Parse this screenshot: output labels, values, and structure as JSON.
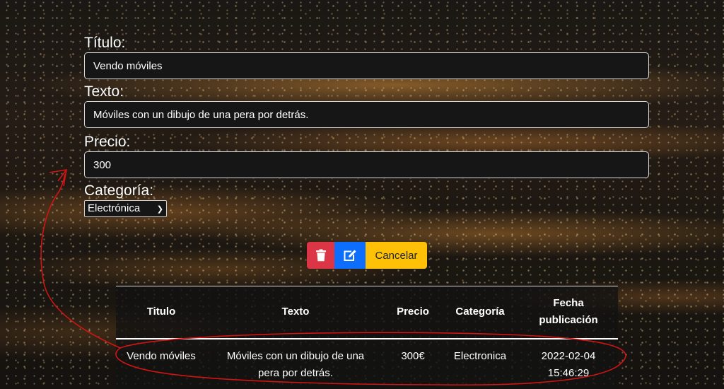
{
  "form": {
    "titulo_label": "Título:",
    "titulo_value": "Vendo móviles",
    "texto_label": "Texto:",
    "texto_value": "Móviles con un dibujo de una pera por detrás.",
    "precio_label": "Precio:",
    "precio_value": "300",
    "categoria_label": "Categoría:",
    "categoria_selected": "Electrónica"
  },
  "buttons": {
    "delete_icon": "trash-icon",
    "edit_icon": "edit-icon",
    "cancel_label": "Cancelar"
  },
  "table": {
    "headers": [
      "Titulo",
      "Texto",
      "Precio",
      "Categoría",
      "Fecha publicación"
    ],
    "rows": [
      [
        "Vendo móviles",
        "Móviles con un dibujo de una pera por detrás.",
        "300€",
        "Electronica",
        "2022-02-04 15:46:29"
      ]
    ]
  },
  "colors": {
    "delete": "#dc3545",
    "edit": "#0d6efd",
    "cancel": "#ffc107",
    "annotation": "#d11414"
  }
}
